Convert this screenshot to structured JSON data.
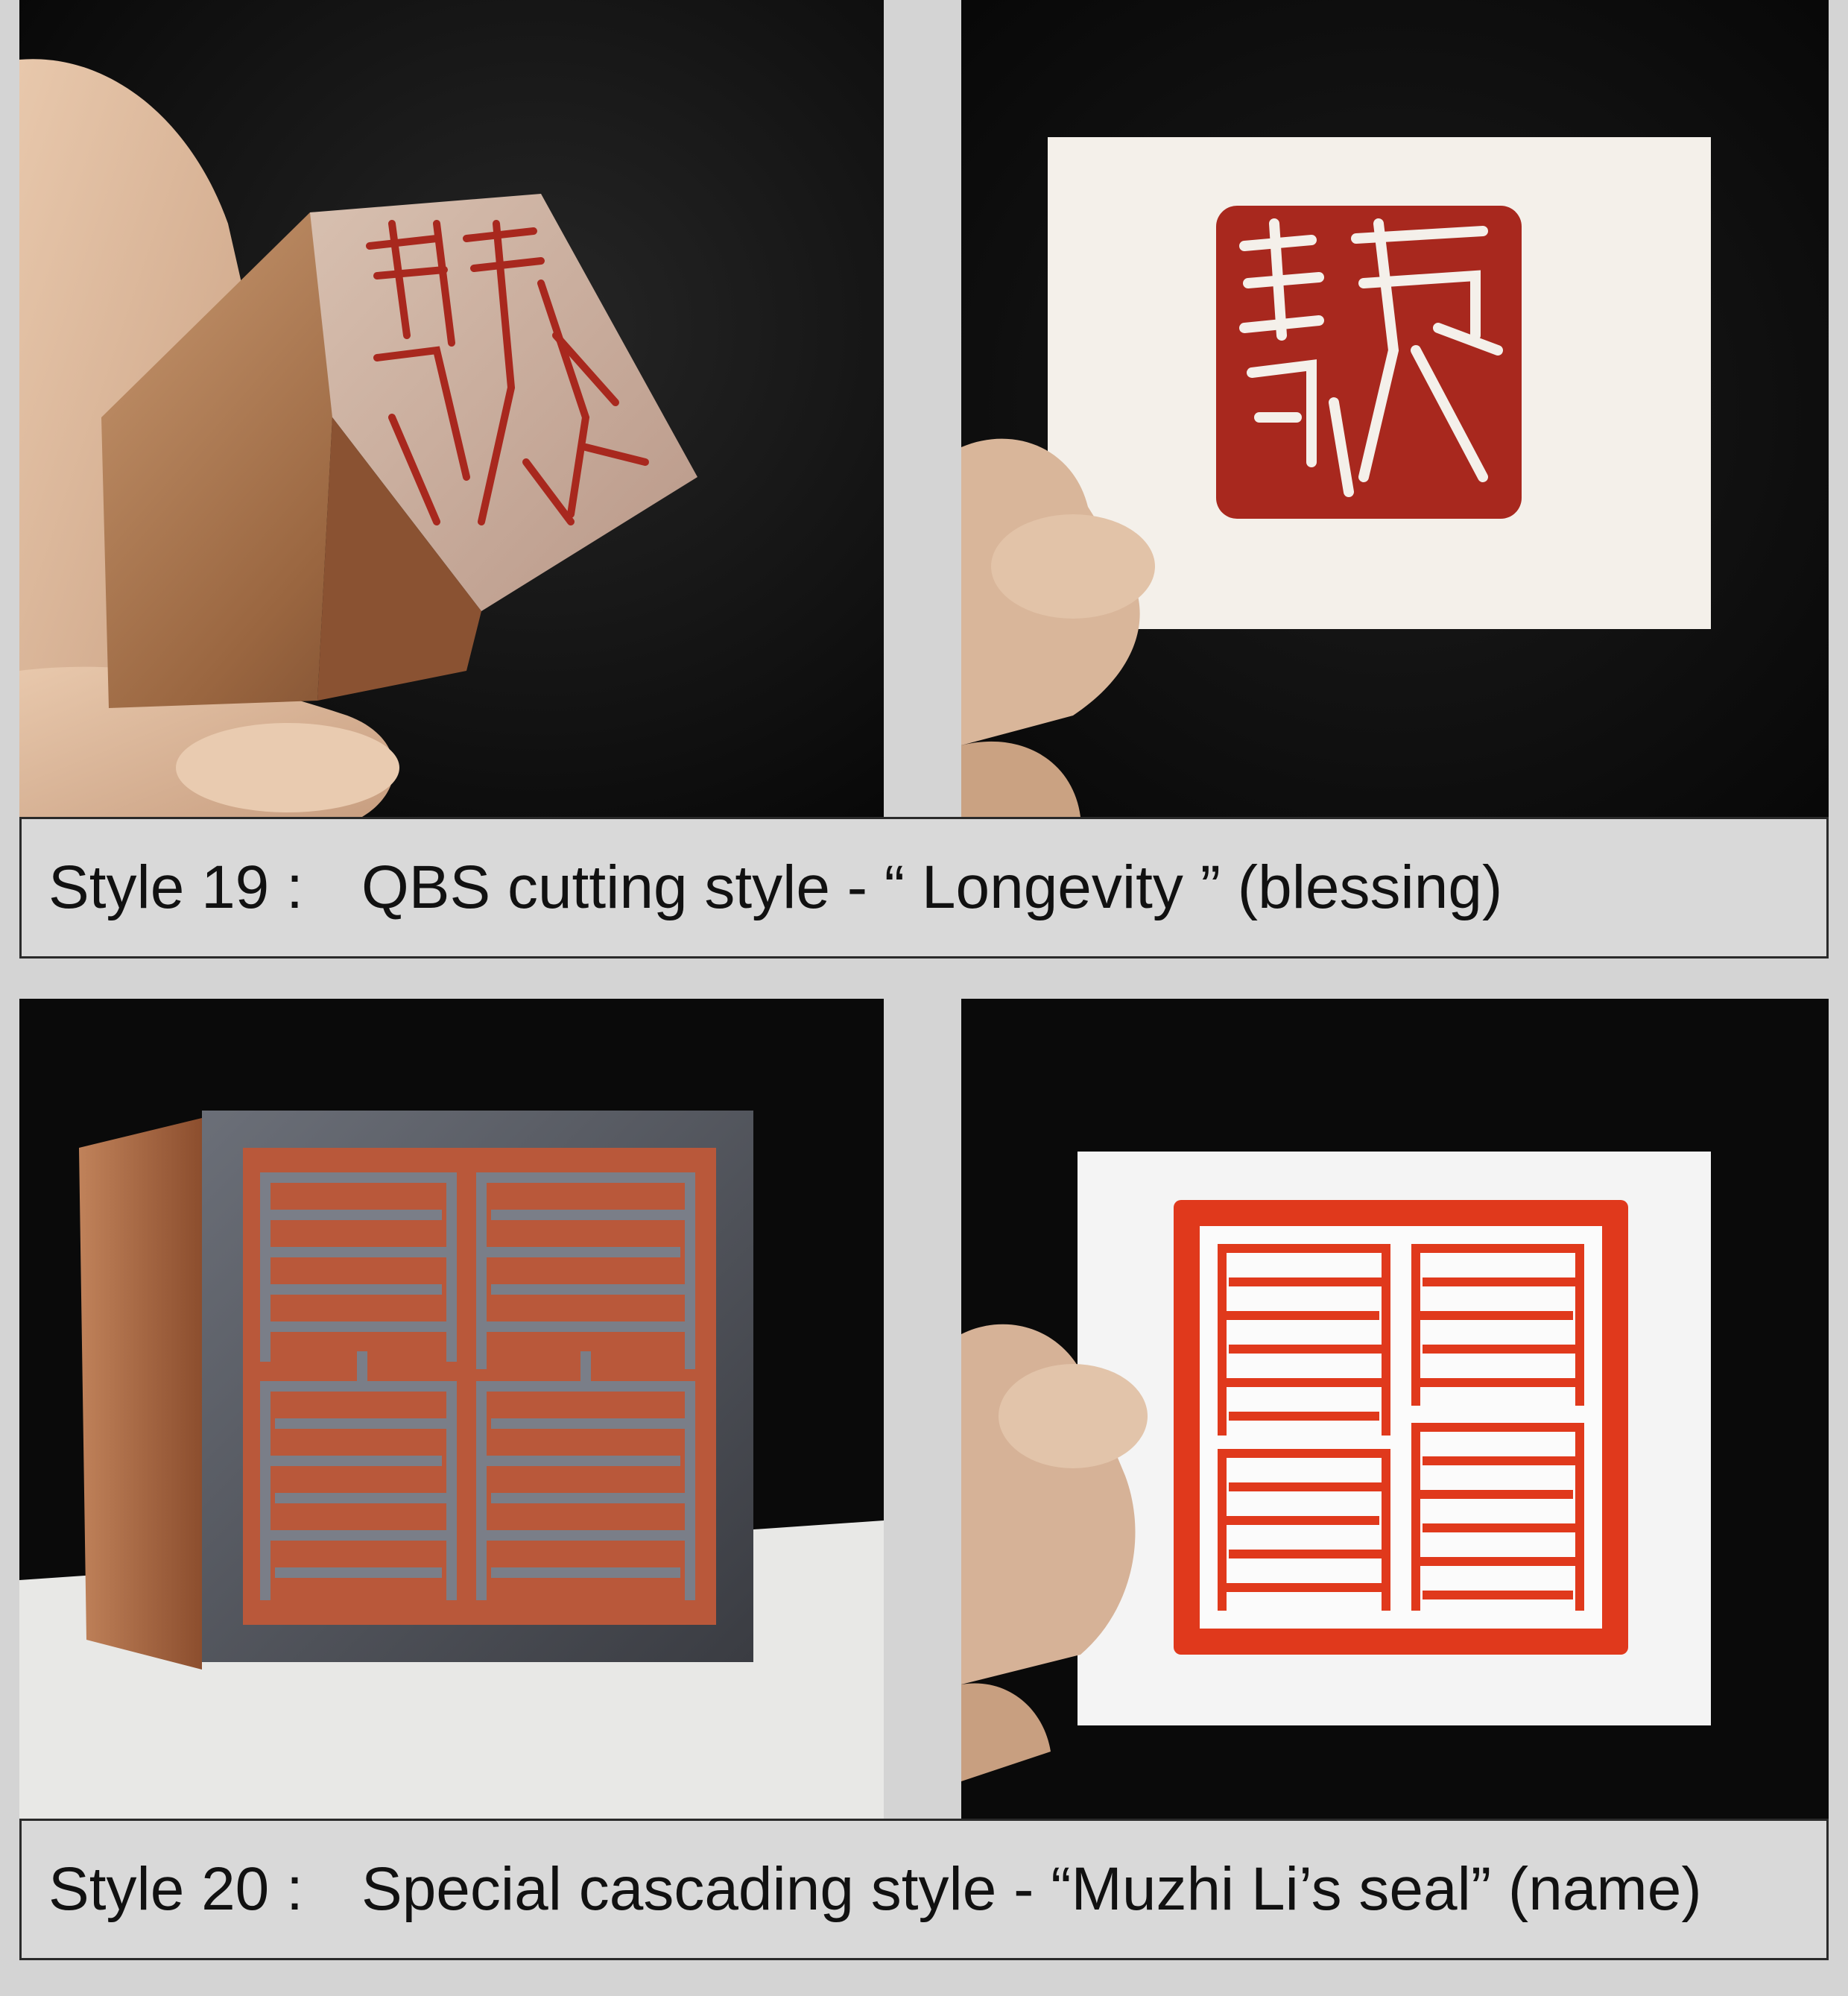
{
  "sections": [
    {
      "style_label": "Style 19 :",
      "description": "QBS cutting style - “ Longevity ” (blessing)"
    },
    {
      "style_label": "Style 20 :",
      "description": "Special cascading style - “Muzhi Li’s seal” (name)"
    }
  ],
  "colors": {
    "seal_red_dark": "#a8281e",
    "seal_red_bright": "#e0391c",
    "stone_tan": "#b07a52",
    "background": "#d4d4d4",
    "photo_black": "#0a0a0a"
  }
}
